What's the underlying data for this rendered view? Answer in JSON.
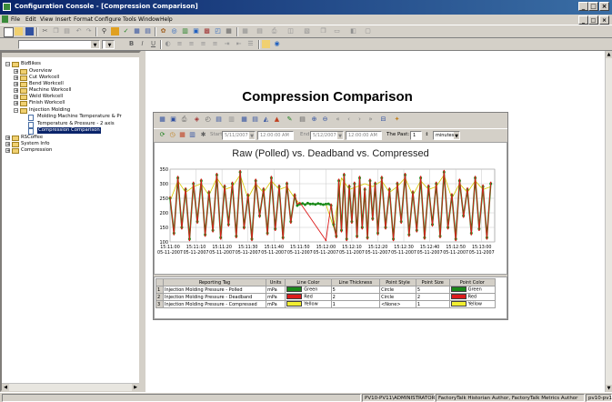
{
  "window": {
    "title": "Configuration Console - [Compression Comparison]",
    "minimize": "_",
    "restore": "□",
    "close": "×"
  },
  "menu": [
    "File",
    "Edit",
    "View",
    "Insert",
    "Format",
    "Configure",
    "Tools",
    "Window",
    "Help"
  ],
  "format_bar": {
    "bold": "B",
    "italic": "I",
    "underline": "U"
  },
  "tree": {
    "items": [
      {
        "label": "BizBikes",
        "expander": "−",
        "kind": "folder"
      },
      {
        "label": "Overview",
        "expander": "+",
        "kind": "folder"
      },
      {
        "label": "Cut Workcell",
        "expander": "+",
        "kind": "folder"
      },
      {
        "label": "Bend Workcell",
        "expander": "+",
        "kind": "folder"
      },
      {
        "label": "Machine Workcell",
        "expander": "+",
        "kind": "folder"
      },
      {
        "label": "Weld Workcell",
        "expander": "+",
        "kind": "folder"
      },
      {
        "label": "Finish Workcell",
        "expander": "+",
        "kind": "folder"
      },
      {
        "label": "Injection Molding",
        "expander": "−",
        "kind": "folder"
      },
      {
        "label": "Molding Machine Temperature & Pr",
        "expander": "",
        "kind": "doc"
      },
      {
        "label": "Temperature & Pressure - 2 axis",
        "expander": "",
        "kind": "doc"
      },
      {
        "label": "Compression Comparison",
        "expander": "",
        "kind": "doc",
        "selected": true
      },
      {
        "label": "RSCoffee",
        "expander": "+",
        "kind": "folder"
      },
      {
        "label": "System Info",
        "expander": "+",
        "kind": "folder"
      },
      {
        "label": "Compression",
        "expander": "+",
        "kind": "folder"
      }
    ]
  },
  "page_title": "Compression Comparison",
  "trend_toolbar": {
    "start_label": "Start",
    "start_date": "5/11/2007",
    "start_time": "12:00:00 AM",
    "end_label": "End",
    "end_date": "5/12/2007",
    "end_time": "12:00:00 AM",
    "past_label": "The Past:",
    "past_value": "1",
    "past_unit": "minutes"
  },
  "chart_data": {
    "type": "line",
    "title": "Raw (Polled) vs. Deadband vs. Compressed",
    "ylim": [
      100,
      350
    ],
    "yticks": [
      100,
      150,
      200,
      250,
      300,
      350
    ],
    "grid": true,
    "xticks": [
      {
        "time": "15:11:00",
        "date": "05-11-2007"
      },
      {
        "time": "15:11:10",
        "date": "05-11-2007"
      },
      {
        "time": "15:11:20",
        "date": "05-11-2007"
      },
      {
        "time": "15:11:30",
        "date": "05-11-2007"
      },
      {
        "time": "15:11:40",
        "date": "05-11-2007"
      },
      {
        "time": "15:11:50",
        "date": "05-11-2007"
      },
      {
        "time": "15:12:00",
        "date": "05-11-2007"
      },
      {
        "time": "15:12:10",
        "date": "05-11-2007"
      },
      {
        "time": "15:12:20",
        "date": "05-11-2007"
      },
      {
        "time": "15:12:30",
        "date": "05-11-2007"
      },
      {
        "time": "15:12:40",
        "date": "05-11-2007"
      },
      {
        "time": "15:12:50",
        "date": "05-11-2007"
      },
      {
        "time": "15:13:00",
        "date": "05-11-2007"
      }
    ],
    "series": [
      {
        "name": "Injection Molding Pressure - Polled",
        "color": "#1a8a1a",
        "x_seconds": [
          0,
          1.5,
          3,
          4.5,
          6,
          7.5,
          9,
          10.5,
          12,
          13.5,
          15,
          16.5,
          18,
          19.5,
          21,
          22.5,
          24,
          25.5,
          27,
          28.5,
          30,
          31.5,
          33,
          34.5,
          36,
          37.5,
          39,
          40.5,
          42,
          43.5,
          45,
          46.5,
          48,
          49,
          50,
          51,
          52,
          53,
          54,
          55,
          56,
          57,
          58,
          59,
          60,
          61,
          62,
          63,
          64,
          65,
          66,
          67,
          68,
          69,
          70,
          71,
          72,
          73,
          74,
          75,
          76,
          77,
          78,
          79,
          80,
          81.5,
          83,
          84.5,
          86,
          87.5,
          89,
          90.5,
          92,
          93.5,
          95,
          96.5,
          98,
          99.5,
          101,
          102.5,
          104,
          105.5,
          107,
          108.5,
          110,
          111.5,
          113,
          114.5,
          116,
          117.5,
          119,
          120.5,
          122,
          123.5
        ],
        "values": [
          250,
          130,
          320,
          150,
          280,
          110,
          300,
          170,
          310,
          125,
          270,
          140,
          330,
          115,
          290,
          160,
          300,
          120,
          340,
          150,
          260,
          110,
          310,
          190,
          280,
          130,
          320,
          145,
          290,
          115,
          300,
          170,
          260,
          225,
          230,
          232,
          228,
          233,
          230,
          231,
          229,
          232,
          230,
          228,
          230,
          231,
          225,
          160,
          120,
          310,
          140,
          330,
          110,
          290,
          170,
          300,
          120,
          320,
          150,
          280,
          115,
          310,
          180,
          300,
          130,
          320,
          150,
          280,
          110,
          300,
          170,
          330,
          125,
          270,
          140,
          320,
          115,
          290,
          160,
          300,
          120,
          340,
          150,
          260,
          110,
          310,
          190,
          280,
          130,
          320,
          145,
          290,
          115,
          300
        ]
      },
      {
        "name": "Injection Molding Pressure - Deadband",
        "color": "#dd1c1c",
        "x_seconds": [
          0,
          1.5,
          3,
          4.5,
          6,
          7.5,
          9,
          10.5,
          12,
          13.5,
          15,
          16.5,
          18,
          19.5,
          21,
          22.5,
          24,
          25.5,
          27,
          28.5,
          30,
          31.5,
          33,
          34.5,
          36,
          37.5,
          39,
          40.5,
          42,
          43.5,
          45,
          46.5,
          48,
          49,
          50,
          60,
          62,
          63,
          64,
          65,
          66,
          67,
          68,
          69,
          70,
          71,
          72,
          73,
          74,
          75,
          76,
          77,
          78,
          79,
          80,
          81.5,
          83,
          84.5,
          86,
          87.5,
          89,
          90.5,
          92,
          93.5,
          95,
          96.5,
          98,
          99.5,
          101,
          102.5,
          104,
          105.5,
          107,
          108.5,
          110,
          111.5,
          113,
          114.5,
          116,
          117.5,
          119,
          120.5,
          122,
          123.5
        ],
        "values": [
          255,
          125,
          325,
          145,
          285,
          105,
          305,
          165,
          315,
          120,
          275,
          135,
          335,
          110,
          295,
          155,
          305,
          115,
          345,
          145,
          265,
          105,
          315,
          185,
          285,
          125,
          325,
          140,
          295,
          110,
          305,
          165,
          265,
          230,
          235,
          105,
          230,
          165,
          115,
          315,
          135,
          335,
          105,
          295,
          165,
          305,
          115,
          325,
          145,
          285,
          110,
          315,
          175,
          305,
          125,
          325,
          145,
          285,
          105,
          305,
          165,
          335,
          120,
          275,
          135,
          325,
          110,
          295,
          155,
          305,
          115,
          345,
          145,
          265,
          105,
          315,
          185,
          285,
          125,
          325,
          140,
          295,
          110,
          305
        ]
      },
      {
        "name": "Injection Molding Pressure - Compressed",
        "color": "#d8c800",
        "x_seconds": [
          0,
          3,
          6,
          9,
          12,
          15,
          18,
          21,
          24,
          27,
          30,
          33,
          36,
          39,
          42,
          45,
          48,
          50,
          60,
          63,
          66,
          69,
          72,
          75,
          78,
          81.5,
          84.5,
          87.5,
          90.5,
          93.5,
          96.5,
          99.5,
          102.5,
          105.5,
          108.5,
          111.5,
          114.5,
          117.5,
          120.5,
          123.5
        ],
        "values": [
          240,
          310,
          270,
          290,
          300,
          260,
          320,
          280,
          290,
          330,
          250,
          300,
          270,
          310,
          280,
          290,
          250,
          230,
          230,
          150,
          320,
          280,
          290,
          300,
          290,
          310,
          270,
          290,
          320,
          260,
          310,
          280,
          290,
          330,
          250,
          300,
          270,
          310,
          280,
          290
        ]
      }
    ]
  },
  "legend": {
    "headers": [
      "",
      "Reporting Tag",
      "Units",
      "Line Color",
      "Line Thickness",
      "Point Style",
      "Point Size",
      "Point Color"
    ],
    "rows": [
      {
        "num": "1",
        "tag": "Injection Molding Pressure - Polled",
        "units": "mPa",
        "line_color": "Green",
        "line_color_hex": "#1a8a1a",
        "thickness": "5",
        "point_style": "Circle",
        "point_size": "5",
        "point_color": "Green",
        "point_color_hex": "#1a8a1a"
      },
      {
        "num": "2",
        "tag": "Injection Molding Pressure - Deadband",
        "units": "mPa",
        "line_color": "Red",
        "line_color_hex": "#dd1c1c",
        "thickness": "2",
        "point_style": "Circle",
        "point_size": "2",
        "point_color": "Red",
        "point_color_hex": "#dd1c1c"
      },
      {
        "num": "3",
        "tag": "Injection Molding Pressure - Compressed",
        "units": "mPa",
        "line_color": "Yellow",
        "line_color_hex": "#f2ee30",
        "thickness": "1",
        "point_style": "<None>",
        "point_size": "1",
        "point_color": "Yellow",
        "point_color_hex": "#f2ee30"
      }
    ]
  },
  "status": {
    "user": "PV10-PV11\\ADMINISTRATOR",
    "product": "FactoryTalk Historian Author, FactoryTalk Metrics Author",
    "host": "pv10-pv11"
  },
  "colors": {
    "titlebar_start": "#0a246a",
    "titlebar_end": "#3a6ea5",
    "chrome": "#d4d0c8",
    "selection": "#0a246a"
  }
}
